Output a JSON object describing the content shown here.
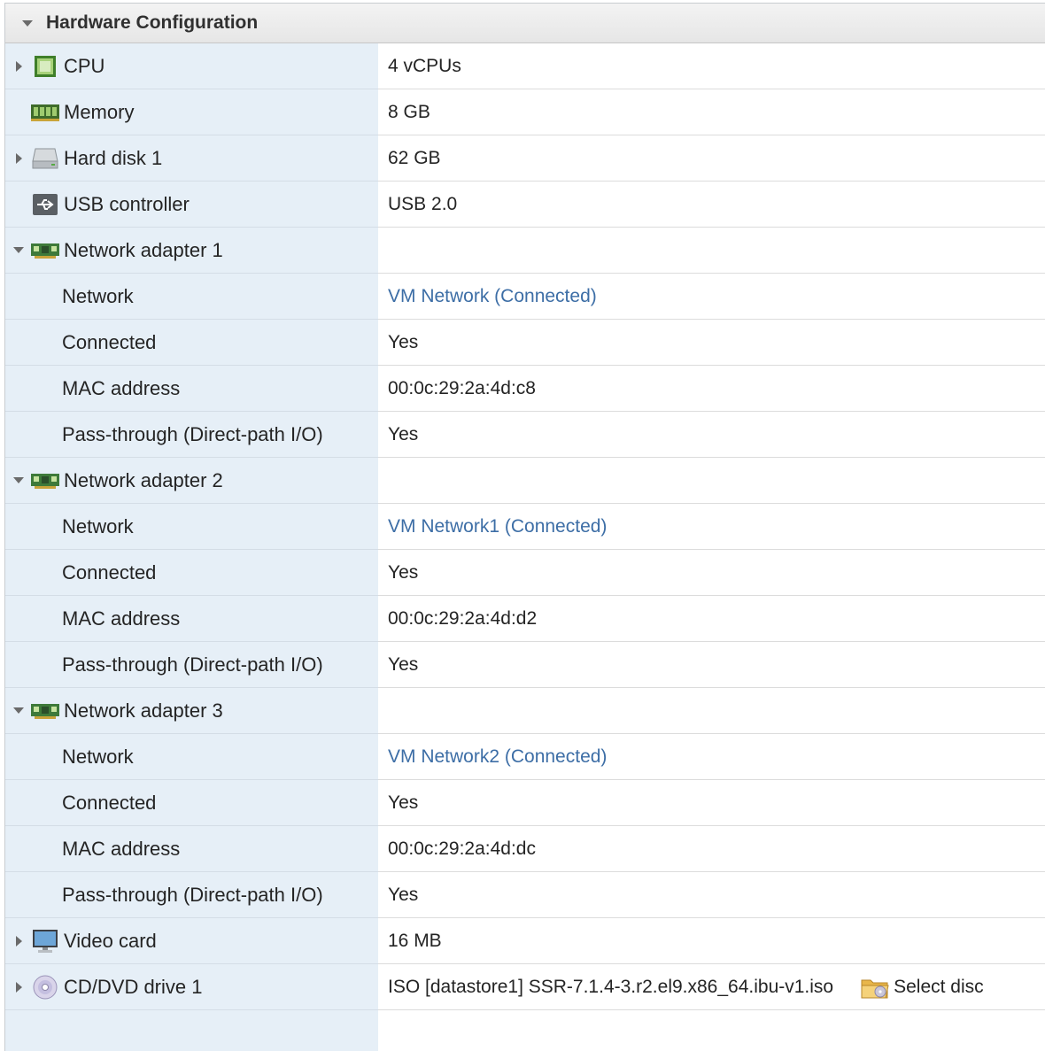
{
  "section": {
    "title": "Hardware Configuration"
  },
  "rows": {
    "cpu": {
      "label": "CPU",
      "value": "4 vCPUs"
    },
    "memory": {
      "label": "Memory",
      "value": "8 GB"
    },
    "hard_disk": {
      "label": "Hard disk 1",
      "value": "62 GB"
    },
    "usb": {
      "label": "USB controller",
      "value": "USB 2.0"
    },
    "net1": {
      "label": "Network adapter 1",
      "network_label": "Network",
      "network_value": "VM Network (Connected)",
      "connected_label": "Connected",
      "connected_value": "Yes",
      "mac_label": "MAC address",
      "mac_value": "00:0c:29:2a:4d:c8",
      "passthrough_label": "Pass-through (Direct-path I/O)",
      "passthrough_value": "Yes"
    },
    "net2": {
      "label": "Network adapter 2",
      "network_label": "Network",
      "network_value": "VM Network1 (Connected)",
      "connected_label": "Connected",
      "connected_value": "Yes",
      "mac_label": "MAC address",
      "mac_value": "00:0c:29:2a:4d:d2",
      "passthrough_label": "Pass-through (Direct-path I/O)",
      "passthrough_value": "Yes"
    },
    "net3": {
      "label": "Network adapter 3",
      "network_label": "Network",
      "network_value": "VM Network2 (Connected)",
      "connected_label": "Connected",
      "connected_value": "Yes",
      "mac_label": "MAC address",
      "mac_value": "00:0c:29:2a:4d:dc",
      "passthrough_label": "Pass-through (Direct-path I/O)",
      "passthrough_value": "Yes"
    },
    "video": {
      "label": "Video card",
      "value": "16 MB"
    },
    "cddvd": {
      "label": "CD/DVD drive 1",
      "value": "ISO [datastore1] SSR-7.1.4-3.r2.el9.x86_64.ibu-v1.iso",
      "select_label": "Select disc"
    }
  },
  "colors": {
    "label_bg": "#e6eff7",
    "link": "#3d6ea6",
    "header_bg": "#ececec"
  }
}
